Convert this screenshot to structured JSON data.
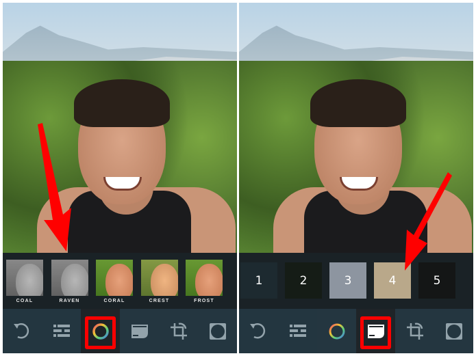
{
  "left_panel": {
    "filters": [
      {
        "label": "COAL",
        "tone": "bw"
      },
      {
        "label": "RAVEN",
        "tone": "bw"
      },
      {
        "label": "CORAL",
        "tone": "color"
      },
      {
        "label": "CREST",
        "tone": "warm"
      },
      {
        "label": "FROST",
        "tone": "color"
      }
    ],
    "selected_tool": "filters"
  },
  "right_panel": {
    "textures": [
      {
        "label": "1",
        "color": "#1d2a30"
      },
      {
        "label": "2",
        "color": "#151c16"
      },
      {
        "label": "3",
        "color": "#8d95a0"
      },
      {
        "label": "4",
        "color": "#b9a88a"
      },
      {
        "label": "5",
        "color": "#141616"
      }
    ],
    "selected_tool": "textures"
  },
  "toolbar": {
    "tools": [
      "undo-icon",
      "adjust-sliders-icon",
      "filter-ring-icon",
      "film-texture-icon",
      "crop-rotate-icon",
      "vignette-icon"
    ]
  },
  "colors": {
    "highlight": "#ff0000",
    "toolbar": "#243640"
  }
}
